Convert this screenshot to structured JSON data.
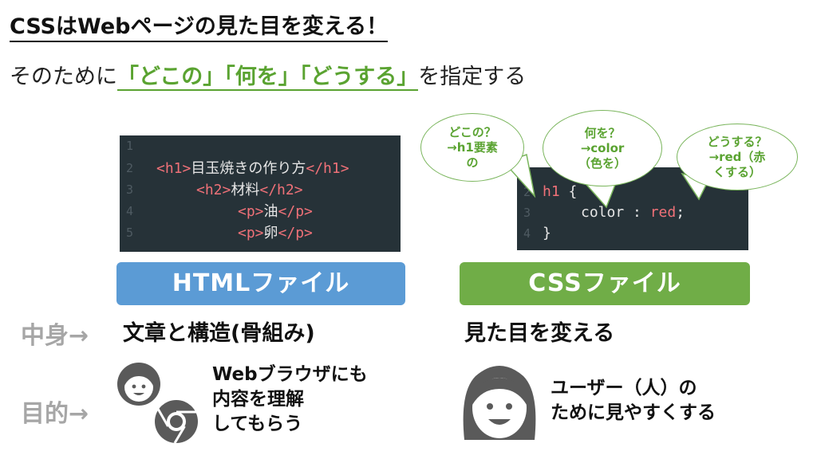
{
  "title": "CSSはWebページの見た目を変える！",
  "subtitle": {
    "prefix": "そのために",
    "where": "「どこの」",
    "what": "「何を」",
    "how": "「どうする」",
    "suffix": "を指定する"
  },
  "html_code": {
    "line_numbers": [
      "1",
      "2",
      "3",
      "4",
      "5"
    ],
    "lines": [
      {
        "open": "<h1>",
        "text": "目玉焼きの作り方",
        "close": "</h1>"
      },
      {
        "open": "<h2>",
        "text": "材料",
        "close": "</h2>"
      },
      {
        "open": "<p>",
        "text": "油",
        "close": "</p>"
      },
      {
        "open": "<p>",
        "text": "卵",
        "close": "</p>"
      }
    ]
  },
  "css_code": {
    "line_numbers": [
      "2",
      "3",
      "4"
    ],
    "selector": "h1",
    "open_brace": "{",
    "property": "color",
    "colon": ":",
    "value": "red",
    "semicolon": ";",
    "close_brace": "}"
  },
  "bubbles": {
    "where": "どこの？\n→h1要素\nの",
    "what": "何を？\n→color\n（色を）",
    "how": "どうする？\n→red（赤\nくする）"
  },
  "html_banner": "HTMLファイル",
  "css_banner": "CSSファイル",
  "content_label": "中身→",
  "html_content": "文章と構造(骨組み)",
  "css_content": "見た目を変える",
  "purpose_label": "目的→",
  "html_purpose": [
    "Webブラウザにも",
    "内容を理解",
    "してもらう"
  ],
  "css_purpose": [
    "ユーザー（人）の",
    "ために見やすくする"
  ],
  "icons": {
    "person_small": "person-face-icon",
    "browser": "chrome-browser-icon",
    "person_large": "person-face-icon"
  },
  "colors": {
    "html_banner": "#5b9bd5",
    "css_banner": "#70ad47",
    "accent_green": "#5aa331",
    "code_bg": "#263238",
    "label_gray": "#a6a6a6"
  }
}
